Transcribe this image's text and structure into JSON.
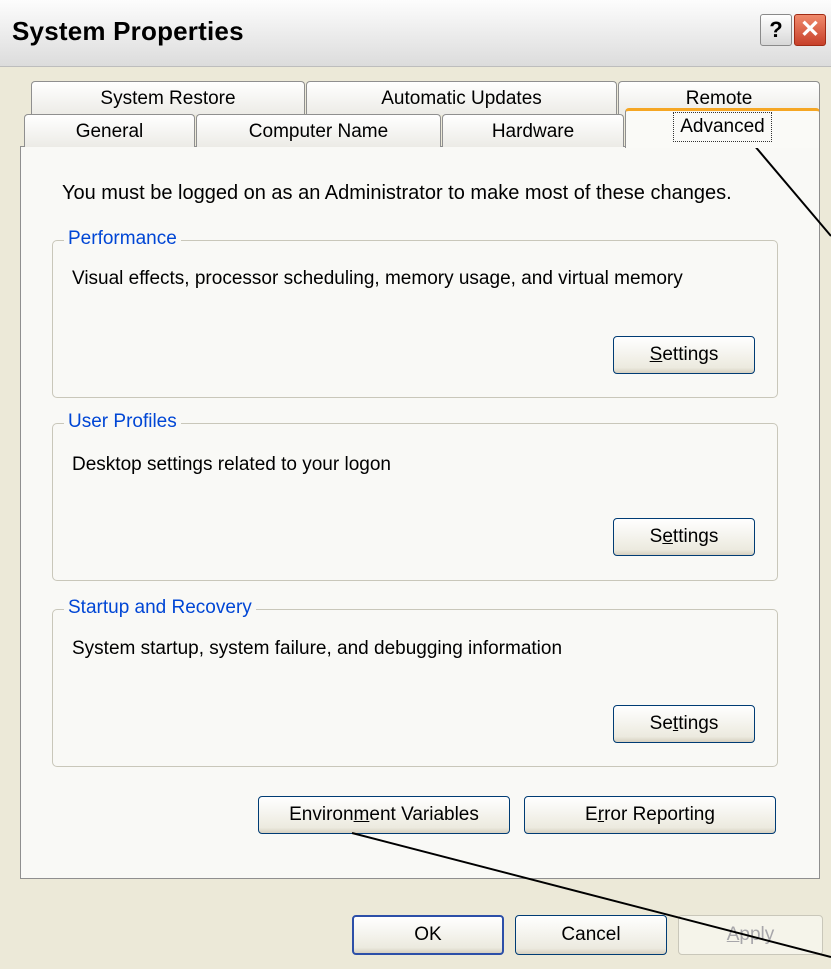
{
  "window": {
    "title": "System Properties",
    "help_glyph": "?",
    "close_glyph": "✕"
  },
  "tabs": {
    "row_back": [
      "System Restore",
      "Automatic Updates",
      "Remote"
    ],
    "row_front": [
      "General",
      "Computer Name",
      "Hardware",
      "Advanced"
    ],
    "active": "Advanced"
  },
  "main": {
    "admin_note": "You must be logged on as an Administrator to make most of these changes."
  },
  "groups": {
    "performance": {
      "title": "Performance",
      "desc": "Visual effects, processor scheduling, memory usage, and virtual memory",
      "btn_pre": "",
      "btn_key": "S",
      "btn_post": "ettings"
    },
    "user_profiles": {
      "title": "User Profiles",
      "desc": "Desktop settings related to your logon",
      "btn_pre": "S",
      "btn_key": "e",
      "btn_post": "ttings"
    },
    "startup": {
      "title": "Startup and Recovery",
      "desc": "System startup, system failure, and debugging information",
      "btn_pre": "Se",
      "btn_key": "t",
      "btn_post": "tings"
    }
  },
  "bottom_buttons": {
    "env_pre": "Environ",
    "env_key": "m",
    "env_post": "ent Variables",
    "err_pre": "E",
    "err_key": "r",
    "err_post": "ror Reporting"
  },
  "dialog_buttons": {
    "ok": "OK",
    "cancel": "Cancel",
    "apply_key": "A",
    "apply_post": "pply"
  },
  "colors": {
    "active_tab_accent": "#f5a623",
    "group_title": "#0046d5",
    "close_button": "#c7402a"
  }
}
